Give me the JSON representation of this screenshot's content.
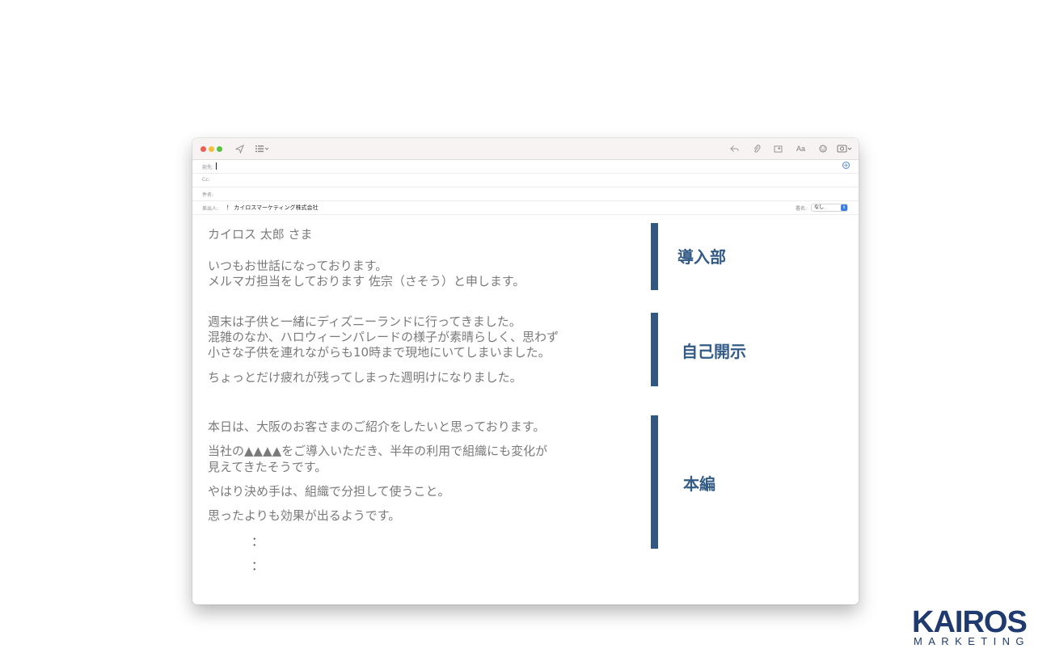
{
  "compose": {
    "to_label": "宛先:",
    "cc_label": "Cc:",
    "subject_label": "件名:",
    "from_label": "差出人:",
    "from_value": "！ カイロスマーケティング株式会社",
    "signature_label": "署名:",
    "signature_value": "なし"
  },
  "toolbar": {
    "format_label": "Aa"
  },
  "body": {
    "lines": [
      "カイロス 太郎 さま",
      "いつもお世話になっております。",
      "メルマガ担当をしております 佐宗（さそう）と申します。",
      "週末は子供と一緒にディズニーランドに行ってきました。",
      "混雑のなか、ハロウィーンパレードの様子が素晴らしく、思わず",
      "小さな子供を連れながらも10時まで現地にいてしまいました。",
      "ちょっとだけ疲れが残ってしまった週明けになりました。",
      "本日は、大阪のお客さまのご紹介をしたいと思っております。",
      "当社の▲▲▲▲をご導入いただき、半年の利用で組織にも変化が",
      "見えてきたそうです。",
      "やはり決め手は、組織で分担して使うこと。",
      "思ったよりも効果が出るようです。"
    ],
    "ellipsis": [
      "：",
      "："
    ]
  },
  "annotations": {
    "intro": "導入部",
    "self_disclosure": "自己開示",
    "main": "本編"
  },
  "brand": {
    "name": "KAIROS",
    "tagline": "MARKETING",
    "bar_color": "#33587f",
    "label_color": "#335b86",
    "logo_color": "#1f3a6e"
  }
}
